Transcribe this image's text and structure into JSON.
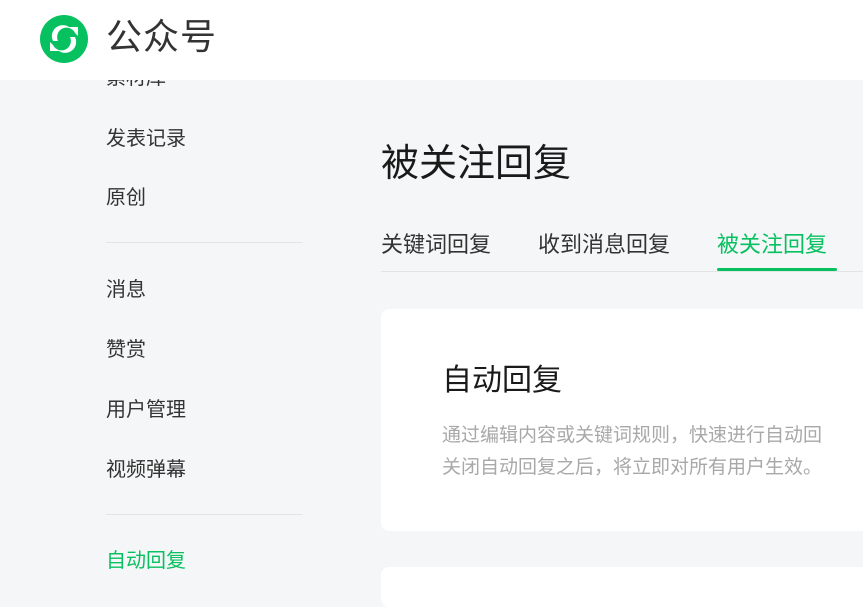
{
  "header": {
    "brand": "公众号",
    "logo_icon": "wechat-official-account-logo-icon",
    "accent": "#07c160"
  },
  "sidebar": {
    "items": [
      {
        "label": "素材库"
      },
      {
        "label": "发表记录"
      },
      {
        "label": "原创"
      },
      {
        "label": "消息"
      },
      {
        "label": "赞赏"
      },
      {
        "label": "用户管理"
      },
      {
        "label": "视频弹幕"
      },
      {
        "label": "自动回复",
        "active": true
      }
    ]
  },
  "main": {
    "title": "被关注回复",
    "tabs": [
      {
        "label": "关键词回复"
      },
      {
        "label": "收到消息回复"
      },
      {
        "label": "被关注回复",
        "active": true
      }
    ],
    "card": {
      "title": "自动回复",
      "desc_line1": "通过编辑内容或关键词规则，快速进行自动回",
      "desc_line2": "关闭自动回复之后，将立即对所有用户生效。"
    }
  }
}
